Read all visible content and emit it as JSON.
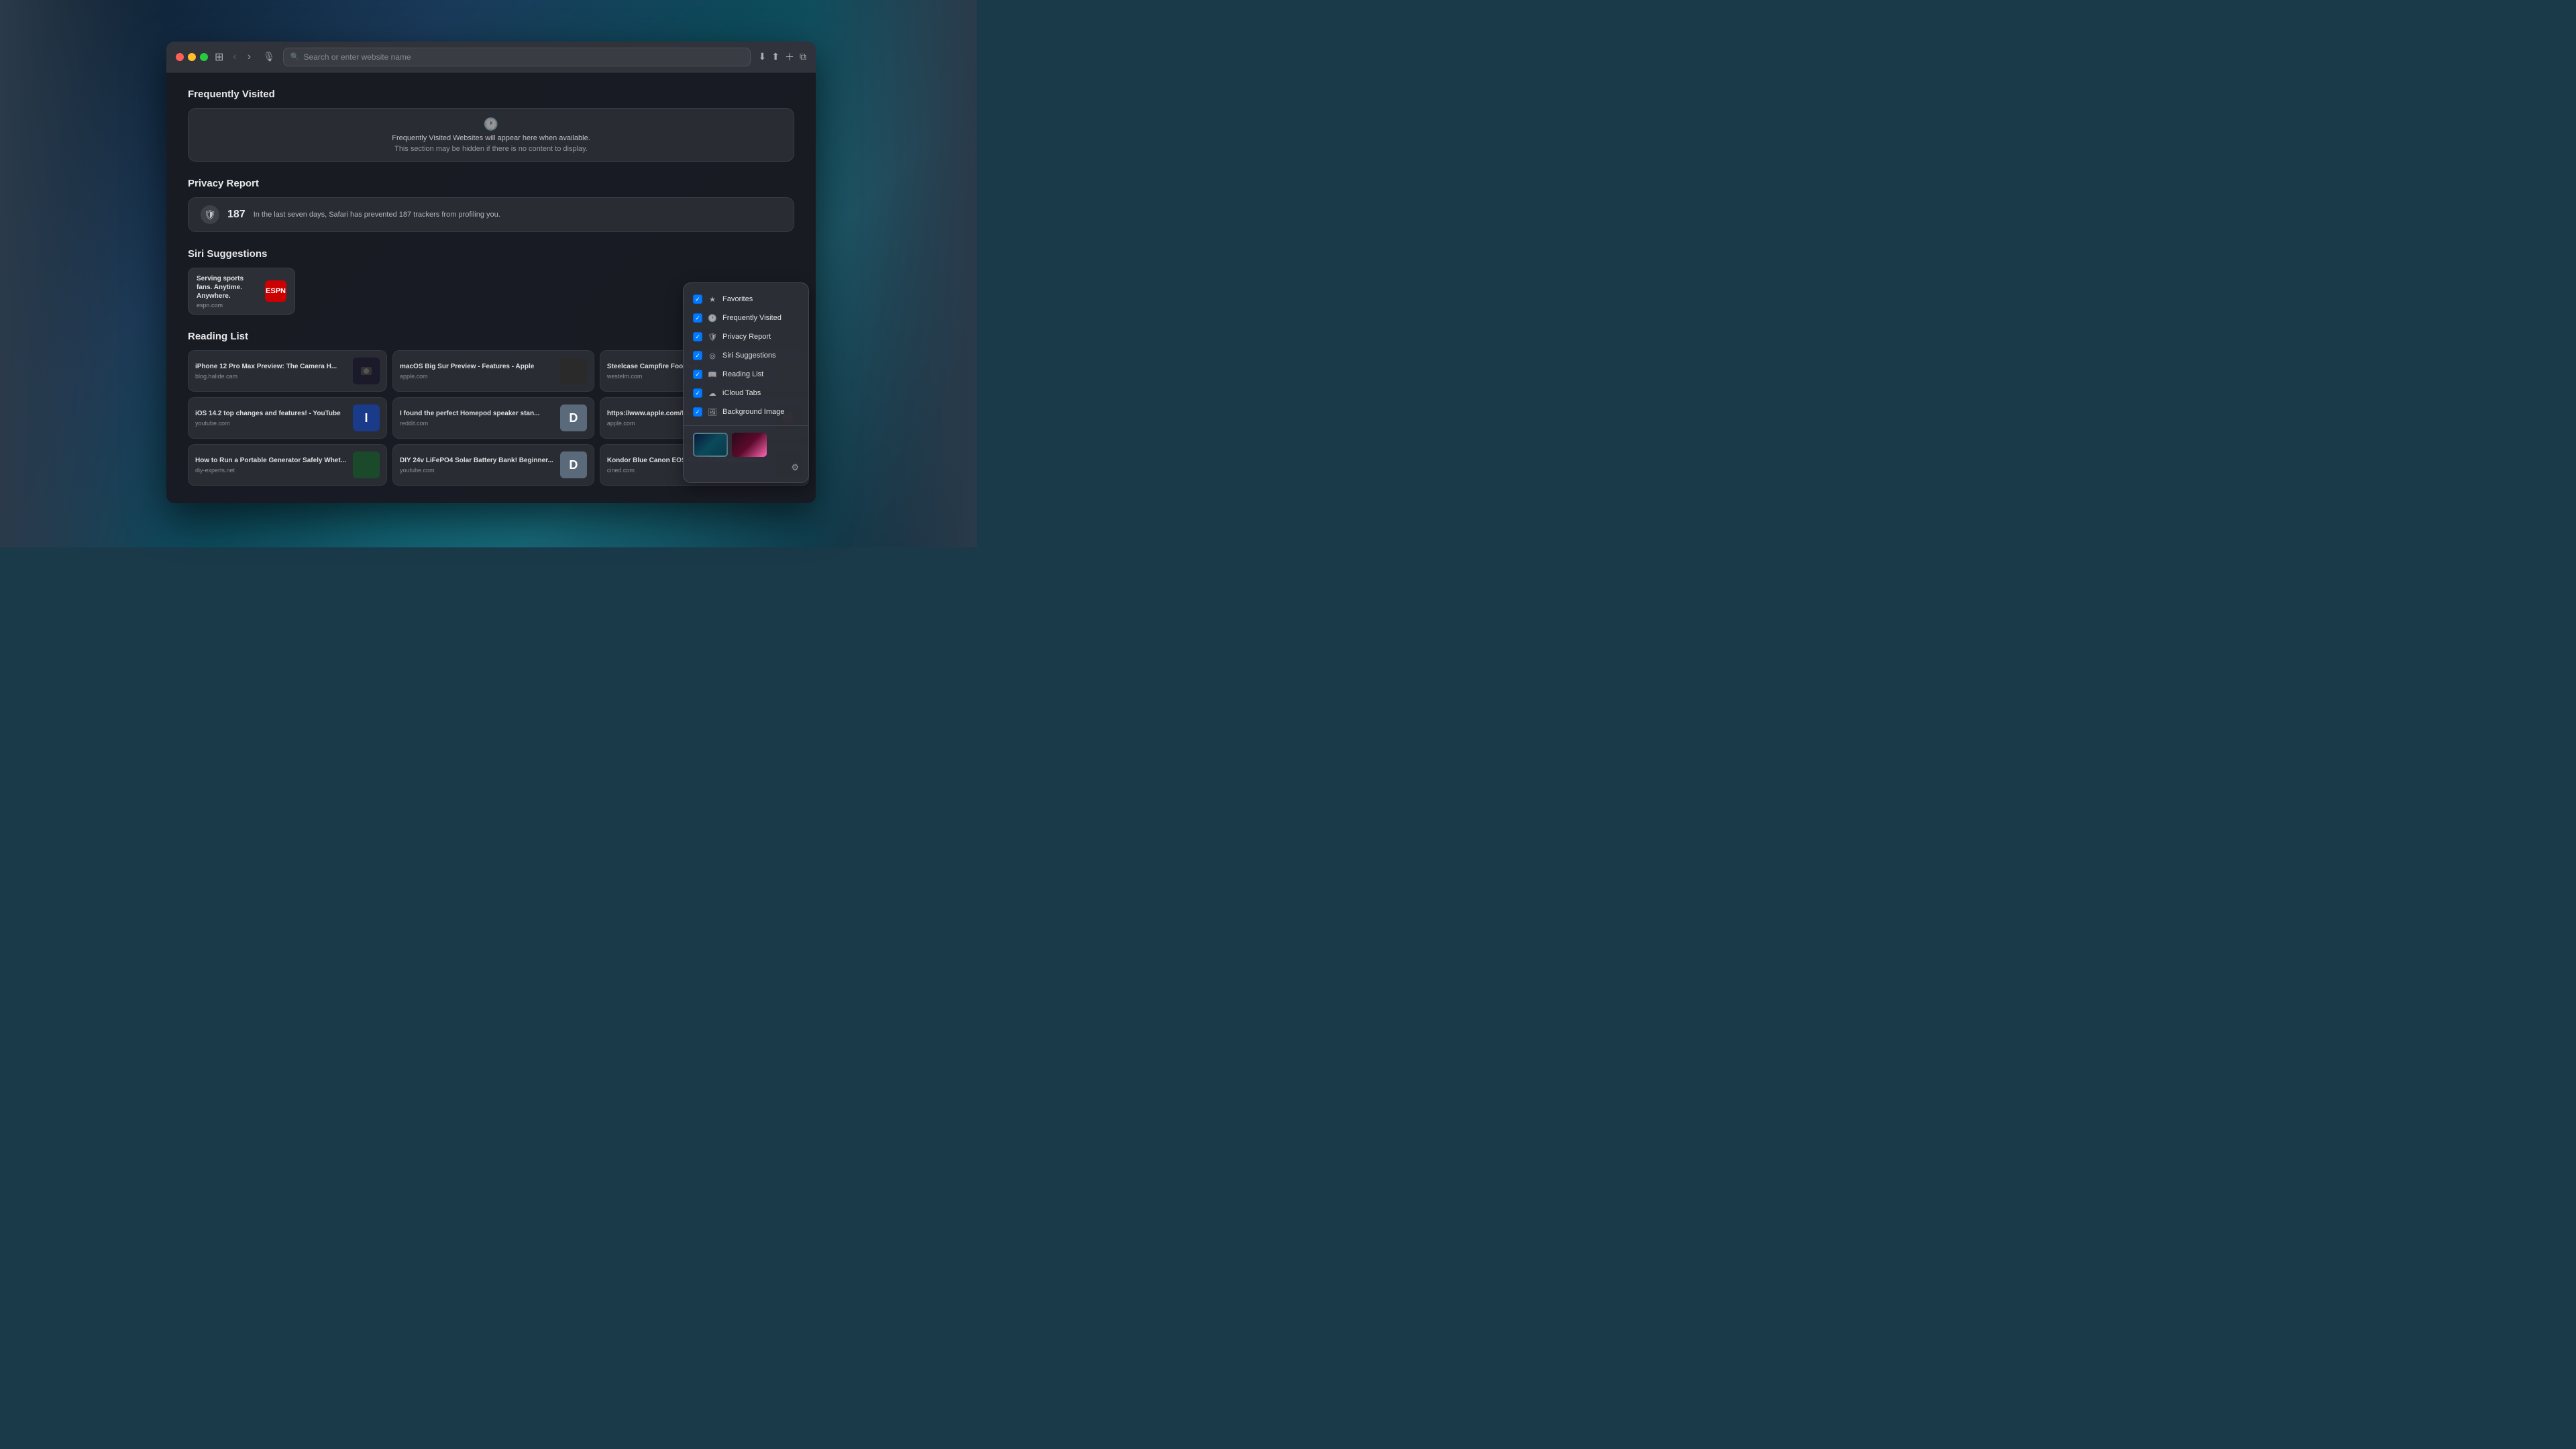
{
  "desktop": {
    "bg_description": "macOS Big Sur wallpaper - cyan grass/rocky landscape"
  },
  "browser": {
    "title_bar": {
      "close_label": "",
      "minimize_label": "",
      "maximize_label": ""
    },
    "address_bar": {
      "placeholder": "Search or enter website name",
      "value": ""
    }
  },
  "frequently_visited": {
    "section_title": "Frequently Visited",
    "placeholder_line1": "Frequently Visited Websites will appear here when available.",
    "placeholder_line2": "This section may be hidden if there is no content to display."
  },
  "privacy_report": {
    "section_title": "Privacy Report",
    "count": "187",
    "description": "In the last seven days, Safari has prevented 187 trackers from profiling you."
  },
  "siri_suggestions": {
    "section_title": "Siri Suggestions",
    "items": [
      {
        "title": "Serving sports fans. Anytime. Anywhere.",
        "url": "espn.com",
        "logo_text": "ESPN"
      }
    ]
  },
  "reading_list": {
    "section_title": "Reading List",
    "items": [
      {
        "title": "iPhone 12 Pro Max Preview: The Camera H...",
        "url": "blog.halide.cam",
        "thumb_type": "dark"
      },
      {
        "title": "macOS Big Sur Preview - Features - Apple",
        "url": "apple.com",
        "thumb_type": "apple"
      },
      {
        "title": "Steelcase Campfire Footrest",
        "url": "westelm.com",
        "thumb_type": "gray"
      },
      {
        "title": "iOS 14.2 top changes and features! - YouTube",
        "url": "youtube.com",
        "thumb_text": "I",
        "thumb_type": "blue_letter"
      },
      {
        "title": "I found the perfect Homepod speaker stan...",
        "url": "reddit.com",
        "thumb_text": "D",
        "thumb_type": "gray_letter"
      },
      {
        "title": "https://www.apple.com/final-cut-pro/docs/HD...",
        "url": "apple.com",
        "thumb_type": "apple"
      },
      {
        "title": "How to Run a Portable Generator Safely Whet...",
        "url": "diy-experts.net",
        "thumb_type": "green"
      },
      {
        "title": "DIY 24v LiFePO4 Solar Battery Bank! Beginner...",
        "url": "youtube.com",
        "thumb_text": "D",
        "thumb_type": "gray_letter"
      },
      {
        "title": "Kondor Blue Canon EOS R5/R6 Full Cages Relea...",
        "url": "cined.com",
        "thumb_type": "dark"
      }
    ]
  },
  "customize_panel": {
    "items": [
      {
        "label": "Favorites",
        "checked": true,
        "icon": "★"
      },
      {
        "label": "Frequently Visited",
        "checked": true,
        "icon": "🕐"
      },
      {
        "label": "Privacy Report",
        "checked": true,
        "icon": "🛡"
      },
      {
        "label": "Siri Suggestions",
        "checked": true,
        "icon": "◎"
      },
      {
        "label": "Reading List",
        "checked": true,
        "icon": "📖"
      },
      {
        "label": "iCloud Tabs",
        "checked": true,
        "icon": "☁"
      },
      {
        "label": "Background Image",
        "checked": true,
        "icon": "🖼"
      }
    ]
  }
}
